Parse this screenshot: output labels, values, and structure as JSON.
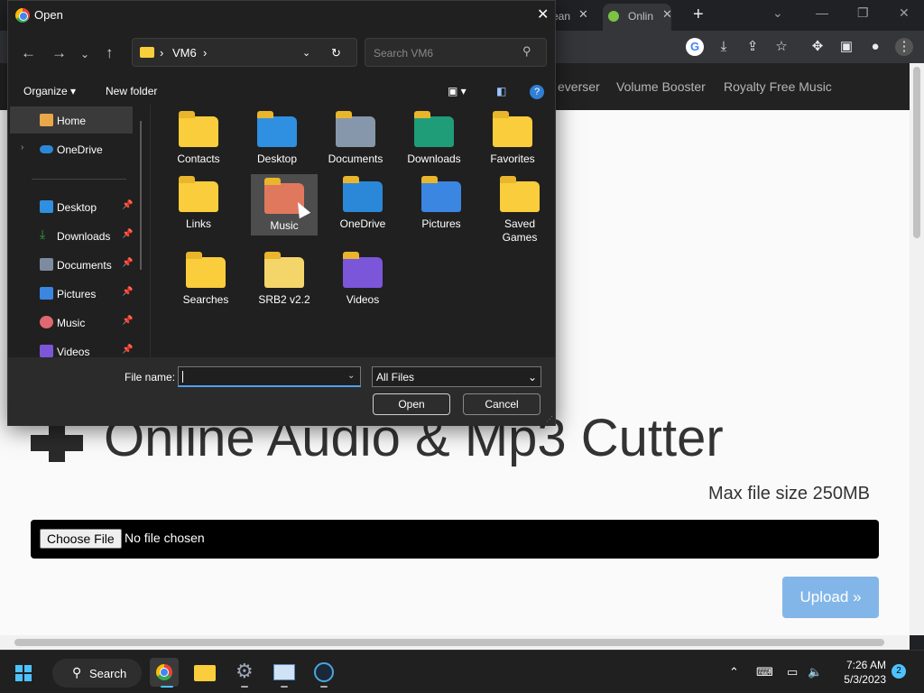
{
  "browser": {
    "tabs": [
      {
        "label": "ean"
      },
      {
        "label": "Onlin"
      }
    ],
    "nav_links": [
      "everser",
      "Volume Booster",
      "Royalty Free Music"
    ]
  },
  "page": {
    "heading": "Online Audio & Mp3 Cutter",
    "max_size": "Max file size 250MB",
    "choose_file": "Choose File",
    "no_file": "No file chosen",
    "upload": "Upload »"
  },
  "dialog": {
    "title": "Open",
    "breadcrumb": [
      "VM6"
    ],
    "search_placeholder": "Search VM6",
    "organize": "Organize",
    "new_folder": "New folder",
    "nav_items": [
      {
        "label": "Home",
        "icon": "home-icon",
        "color": "#e8a84a"
      },
      {
        "label": "OneDrive",
        "icon": "onedrive-icon",
        "color": "#2b88d8"
      },
      {
        "label": "Desktop",
        "icon": "desktop-icon",
        "color": "#2f8fe0"
      },
      {
        "label": "Downloads",
        "icon": "download-icon",
        "color": "#2ea043"
      },
      {
        "label": "Documents",
        "icon": "documents-icon",
        "color": "#7d8ba0"
      },
      {
        "label": "Pictures",
        "icon": "pictures-icon",
        "color": "#3b86e0"
      },
      {
        "label": "Music",
        "icon": "music-icon",
        "color": "#e0686f"
      },
      {
        "label": "Videos",
        "icon": "videos-icon",
        "color": "#7b56d9"
      }
    ],
    "folders": [
      {
        "label": "Contacts",
        "icon": "folder-icon"
      },
      {
        "label": "Desktop",
        "icon": "desktop-folder-icon"
      },
      {
        "label": "Documents",
        "icon": "documents-folder-icon"
      },
      {
        "label": "Downloads",
        "icon": "downloads-folder-icon"
      },
      {
        "label": "Favorites",
        "icon": "folder-icon"
      },
      {
        "label": "Links",
        "icon": "folder-icon"
      },
      {
        "label": "Music",
        "icon": "music-folder-icon"
      },
      {
        "label": "OneDrive",
        "icon": "onedrive-folder-icon"
      },
      {
        "label": "Pictures",
        "icon": "pictures-folder-icon"
      },
      {
        "label": "Saved Games",
        "icon": "folder-icon"
      },
      {
        "label": "Searches",
        "icon": "folder-icon"
      },
      {
        "label": "SRB2 v2.2",
        "icon": "folder-icon"
      },
      {
        "label": "Videos",
        "icon": "videos-folder-icon"
      }
    ],
    "file_name_label": "File name:",
    "file_name_value": "",
    "file_type": "All Files",
    "open_button": "Open",
    "cancel_button": "Cancel"
  },
  "taskbar": {
    "search": "Search",
    "time": "7:26 AM",
    "date": "5/3/2023",
    "notifications": "2"
  }
}
